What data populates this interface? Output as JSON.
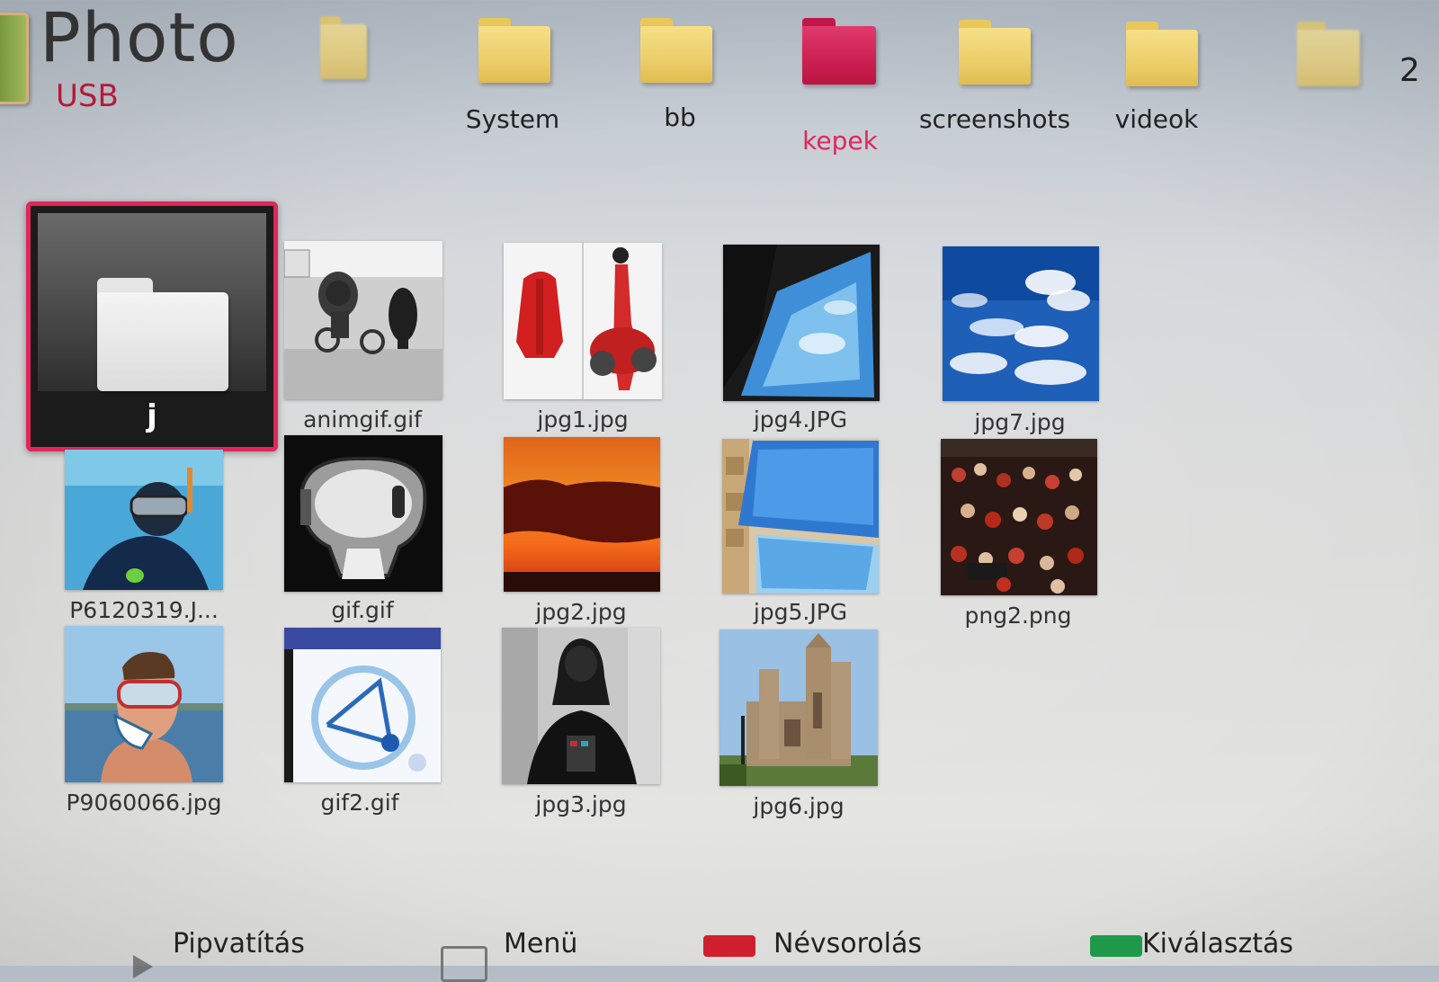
{
  "header": {
    "title": "Photo",
    "source": "USB"
  },
  "folders": [
    {
      "label": "",
      "color": "#ecce6a"
    },
    {
      "label": "System",
      "color": "#ecce6a"
    },
    {
      "label": "bb",
      "color": "#ecce6a"
    },
    {
      "label": "kepek",
      "color": "#cc1f52",
      "selected": true
    },
    {
      "label": "screenshots",
      "color": "#ecce6a"
    },
    {
      "label": "videok",
      "color": "#ecce6a"
    },
    {
      "label": "",
      "color": "#ecce6a"
    }
  ],
  "edge_text": "2",
  "grid": {
    "selected_folder": {
      "label": "j",
      "icon": "folder-icon"
    },
    "items": [
      {
        "label": "animgif.gif"
      },
      {
        "label": "jpg1.jpg"
      },
      {
        "label": "jpg4.JPG"
      },
      {
        "label": "jpg7.jpg"
      },
      {
        "label": "P6120319.J..."
      },
      {
        "label": "gif.gif"
      },
      {
        "label": "jpg2.jpg"
      },
      {
        "label": "jpg5.JPG"
      },
      {
        "label": "png2.png"
      },
      {
        "label": "P9060066.jpg"
      },
      {
        "label": "gif2.gif"
      },
      {
        "label": "jpg3.jpg"
      },
      {
        "label": "jpg6.jpg"
      }
    ]
  },
  "footer": {
    "items": [
      {
        "label": "Pipvatítás",
        "icon": "play-icon"
      },
      {
        "label": "Menü",
        "icon": "square-icon"
      },
      {
        "label": "Névsorolás",
        "icon": "blue-button-icon"
      },
      {
        "label": "Kiválasztás",
        "icon": "green-button-icon"
      }
    ]
  },
  "accent_color": "#e0265c"
}
